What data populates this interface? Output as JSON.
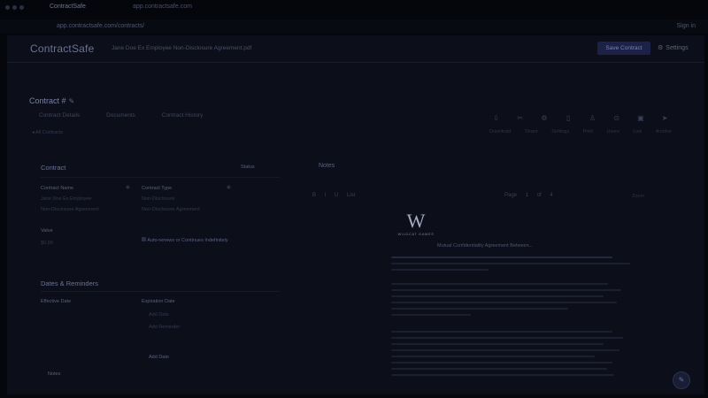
{
  "browser": {
    "tab_title": "ContractSafe",
    "tab_secondary": "app.contractsafe.com",
    "url": "app.contractsafe.com/contracts/",
    "right_text": "Sign in"
  },
  "nav": {
    "logo": "ContractSafe",
    "doc_title": "Jane Doe Ex Employee Non-Disclosure Agreement.pdf",
    "primary_button": "Save Contract",
    "settings_label": "Settings"
  },
  "page": {
    "subheader": "",
    "contract_title": "Contract #",
    "tabs": [
      "Contract Details",
      "Documents",
      "Contract History"
    ],
    "breadcrumb": "All Contracts"
  },
  "toolbar": {
    "icons": [
      "download-icon",
      "share-icon",
      "gear-icon",
      "print-icon",
      "user-icon",
      "link-icon",
      "archive-icon",
      "arrow-icon"
    ],
    "sub_labels": [
      "Download",
      "Share",
      "Settings",
      "Print",
      "Users",
      "Link",
      "Archive"
    ]
  },
  "details": {
    "section_title": "Contract",
    "status_label": "Status",
    "left_label": "Contract Name",
    "left_value": "Jane Doe Ex Employee",
    "left_value2": "Non-Disclosure Agreement",
    "right_label": "Contract Type",
    "right_value": "Non-Disclosure",
    "right_value2": "Non-Disclosure Agreement",
    "value_label": "Value",
    "value_text": "$0.00",
    "check_label": "Auto-renews or Continues Indefinitely",
    "dates_title": "Dates & Reminders",
    "date_left_label": "Effective Date",
    "date_right_label": "Expiration Date",
    "date_right_value1": "Add Date",
    "date_right_value2": "Add Reminder",
    "extra_label": "Add Date",
    "bottom_label": "Notes"
  },
  "notes": {
    "title": "Notes",
    "tools_left": [
      "B",
      "I",
      "U",
      "List"
    ],
    "tools_right": [
      "Page",
      "1",
      "of",
      "4"
    ],
    "far_right": "Zoom"
  },
  "document": {
    "logo_letter": "W",
    "logo_sub": "WILDCAT GAMES",
    "heading": "Mutual Confidentiality Agreement Between..."
  },
  "colors": {
    "background": "#06070d",
    "panel": "#0c0e19",
    "accent": "#1c2148"
  }
}
